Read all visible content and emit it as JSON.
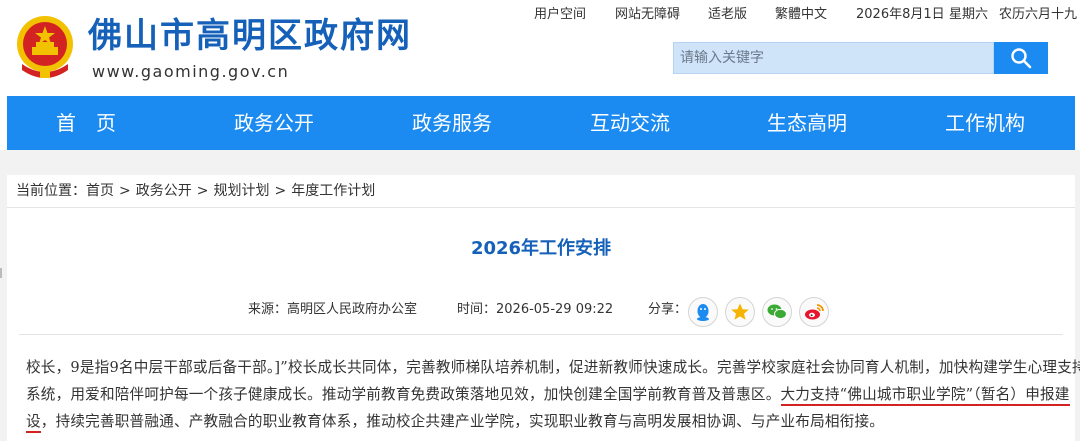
{
  "header": {
    "site_title": "佛山市高明区政府网",
    "site_url": "www.gaoming.gov.cn",
    "top_links": [
      "用户空间",
      "网站无障碍",
      "适老版",
      "繁體中文"
    ],
    "date": "2026年8月1日",
    "weekday": "星期六",
    "lunar_date": "农历六月十九",
    "search_placeholder": "请输入关键字",
    "emblem_color": "#d32222",
    "emblem_gold": "#f2c200"
  },
  "nav": {
    "items": [
      "首　页",
      "政务公开",
      "政务服务",
      "互动交流",
      "生态高明",
      "工作机构"
    ],
    "color": "#1b8bf1"
  },
  "breadcrumb": {
    "label": "当前位置：",
    "items": [
      "首页",
      "政务公开",
      "规划计划",
      "年度工作计划"
    ],
    "separator": ">"
  },
  "article": {
    "title": "2026年工作安排",
    "source_label": "来源：",
    "source": "高明区人民政府办公室",
    "time_label": "时间：",
    "time": "2026-05-29 09:22",
    "share_label": "分享：",
    "share_icons": [
      "qq-icon",
      "qzone-icon",
      "wechat-icon",
      "weibo-icon"
    ],
    "line1": "校长，9是指9名中层干部或后备干部。]”校长成长共同体，完善教师梯队培养机制，促进新教师快速成长。完善学校家庭社会协同育人机制，加快构建学生心理支持",
    "line2_a": "系统，用爱和陪伴呵护每一个孩子健康成长。推动学前教育免费政策落地见效，加快创建全国学前教育普及普惠区。",
    "line2_hl": "大力支持“佛山城市职业学院”（暂名）申报建",
    "line3_hl": "设",
    "line3_b": "，持续完善职普融通、产教融合的职业教育体系，推动校企共建产业学院，实现职业教育与高明发展相协调、与产业布局相衔接。",
    "highlight_color": "#d32222"
  }
}
